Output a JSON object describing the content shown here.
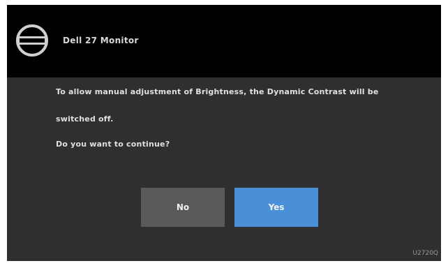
{
  "dialog": {
    "title": "Dell 27 Monitor",
    "logo_icon": "dell-logo-icon",
    "message_line1": "To allow manual adjustment of Brightness, the Dynamic Contrast will be",
    "message_line2": "switched off.",
    "question": "Do you want to continue?",
    "no_label": "No",
    "yes_label": "Yes",
    "model_code": "U2720Q",
    "colors": {
      "titlebar": "#000000",
      "body": "#2f2f2f",
      "no_button": "#5a5a5a",
      "yes_button": "#4a90d8"
    }
  }
}
